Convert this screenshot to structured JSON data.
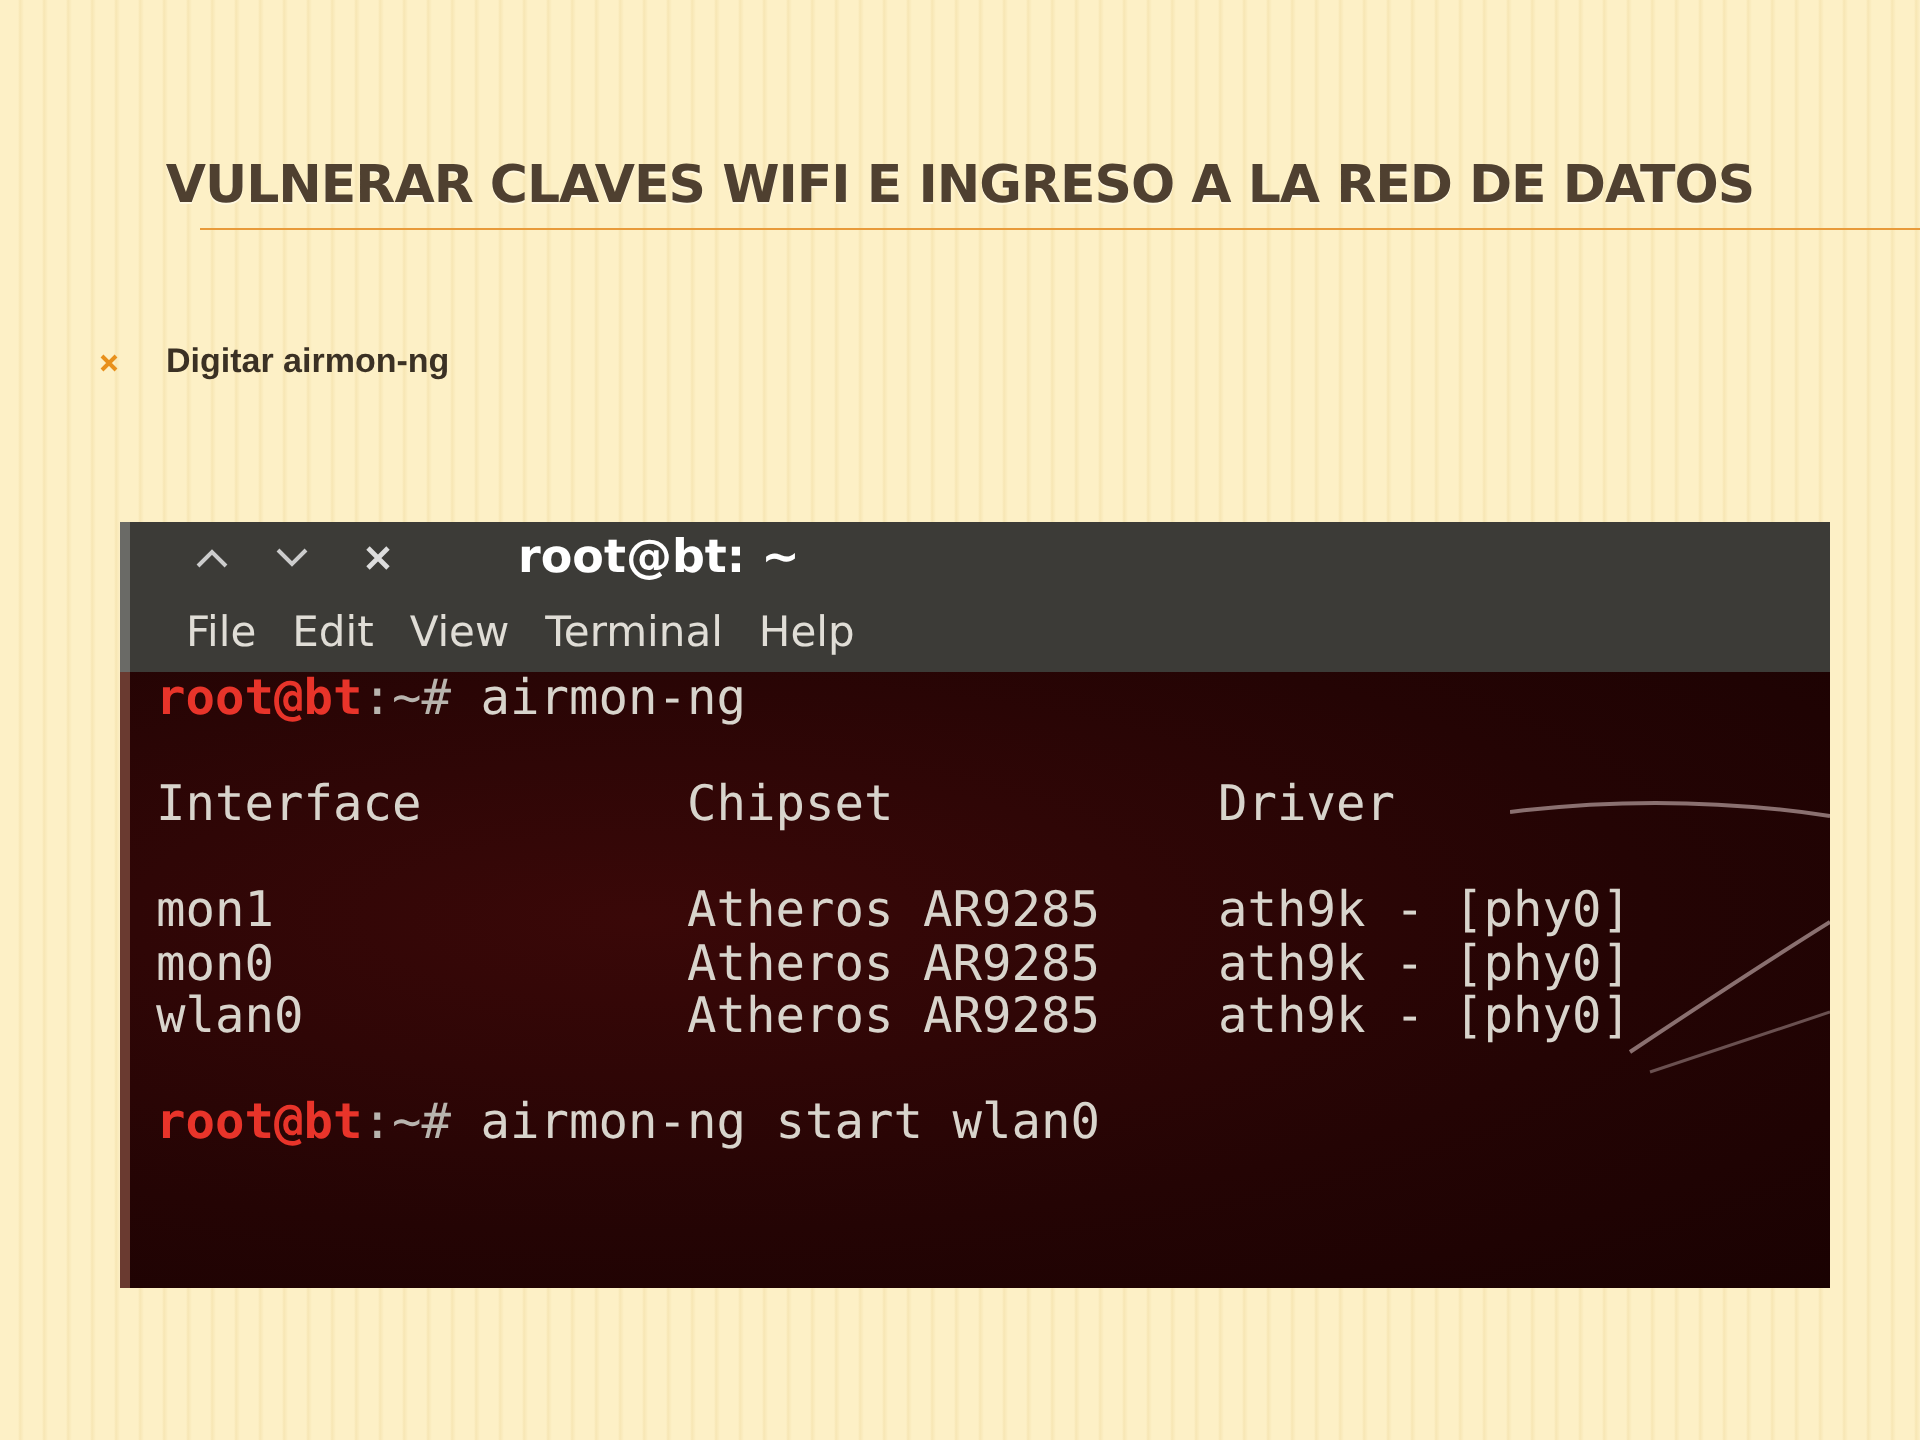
{
  "slide": {
    "title": "VULNERAR CLAVES WIFI E INGRESO A LA RED DE DATOS",
    "bullets": [
      {
        "text": "Digitar airmon-ng"
      }
    ]
  },
  "terminal": {
    "title": "root@bt: ~",
    "menu": [
      "File",
      "Edit",
      "View",
      "Terminal",
      "Help"
    ],
    "lines": [
      {
        "kind": "prompt",
        "user": "root@bt",
        "path": ":~#",
        "command": "airmon-ng"
      },
      {
        "kind": "blank"
      },
      {
        "kind": "columns",
        "cells": [
          "Interface",
          "Chipset",
          "Driver"
        ]
      },
      {
        "kind": "blank"
      },
      {
        "kind": "columns",
        "cells": [
          "mon1",
          "Atheros AR9285",
          "ath9k - [phy0]"
        ]
      },
      {
        "kind": "columns",
        "cells": [
          "mon0",
          "Atheros AR9285",
          "ath9k - [phy0]"
        ]
      },
      {
        "kind": "columns",
        "cells": [
          "wlan0",
          "Atheros AR9285",
          "ath9k - [phy0]"
        ]
      },
      {
        "kind": "blank"
      },
      {
        "kind": "prompt",
        "user": "root@bt",
        "path": ":~#",
        "command": "airmon-ng start wlan0"
      }
    ]
  }
}
